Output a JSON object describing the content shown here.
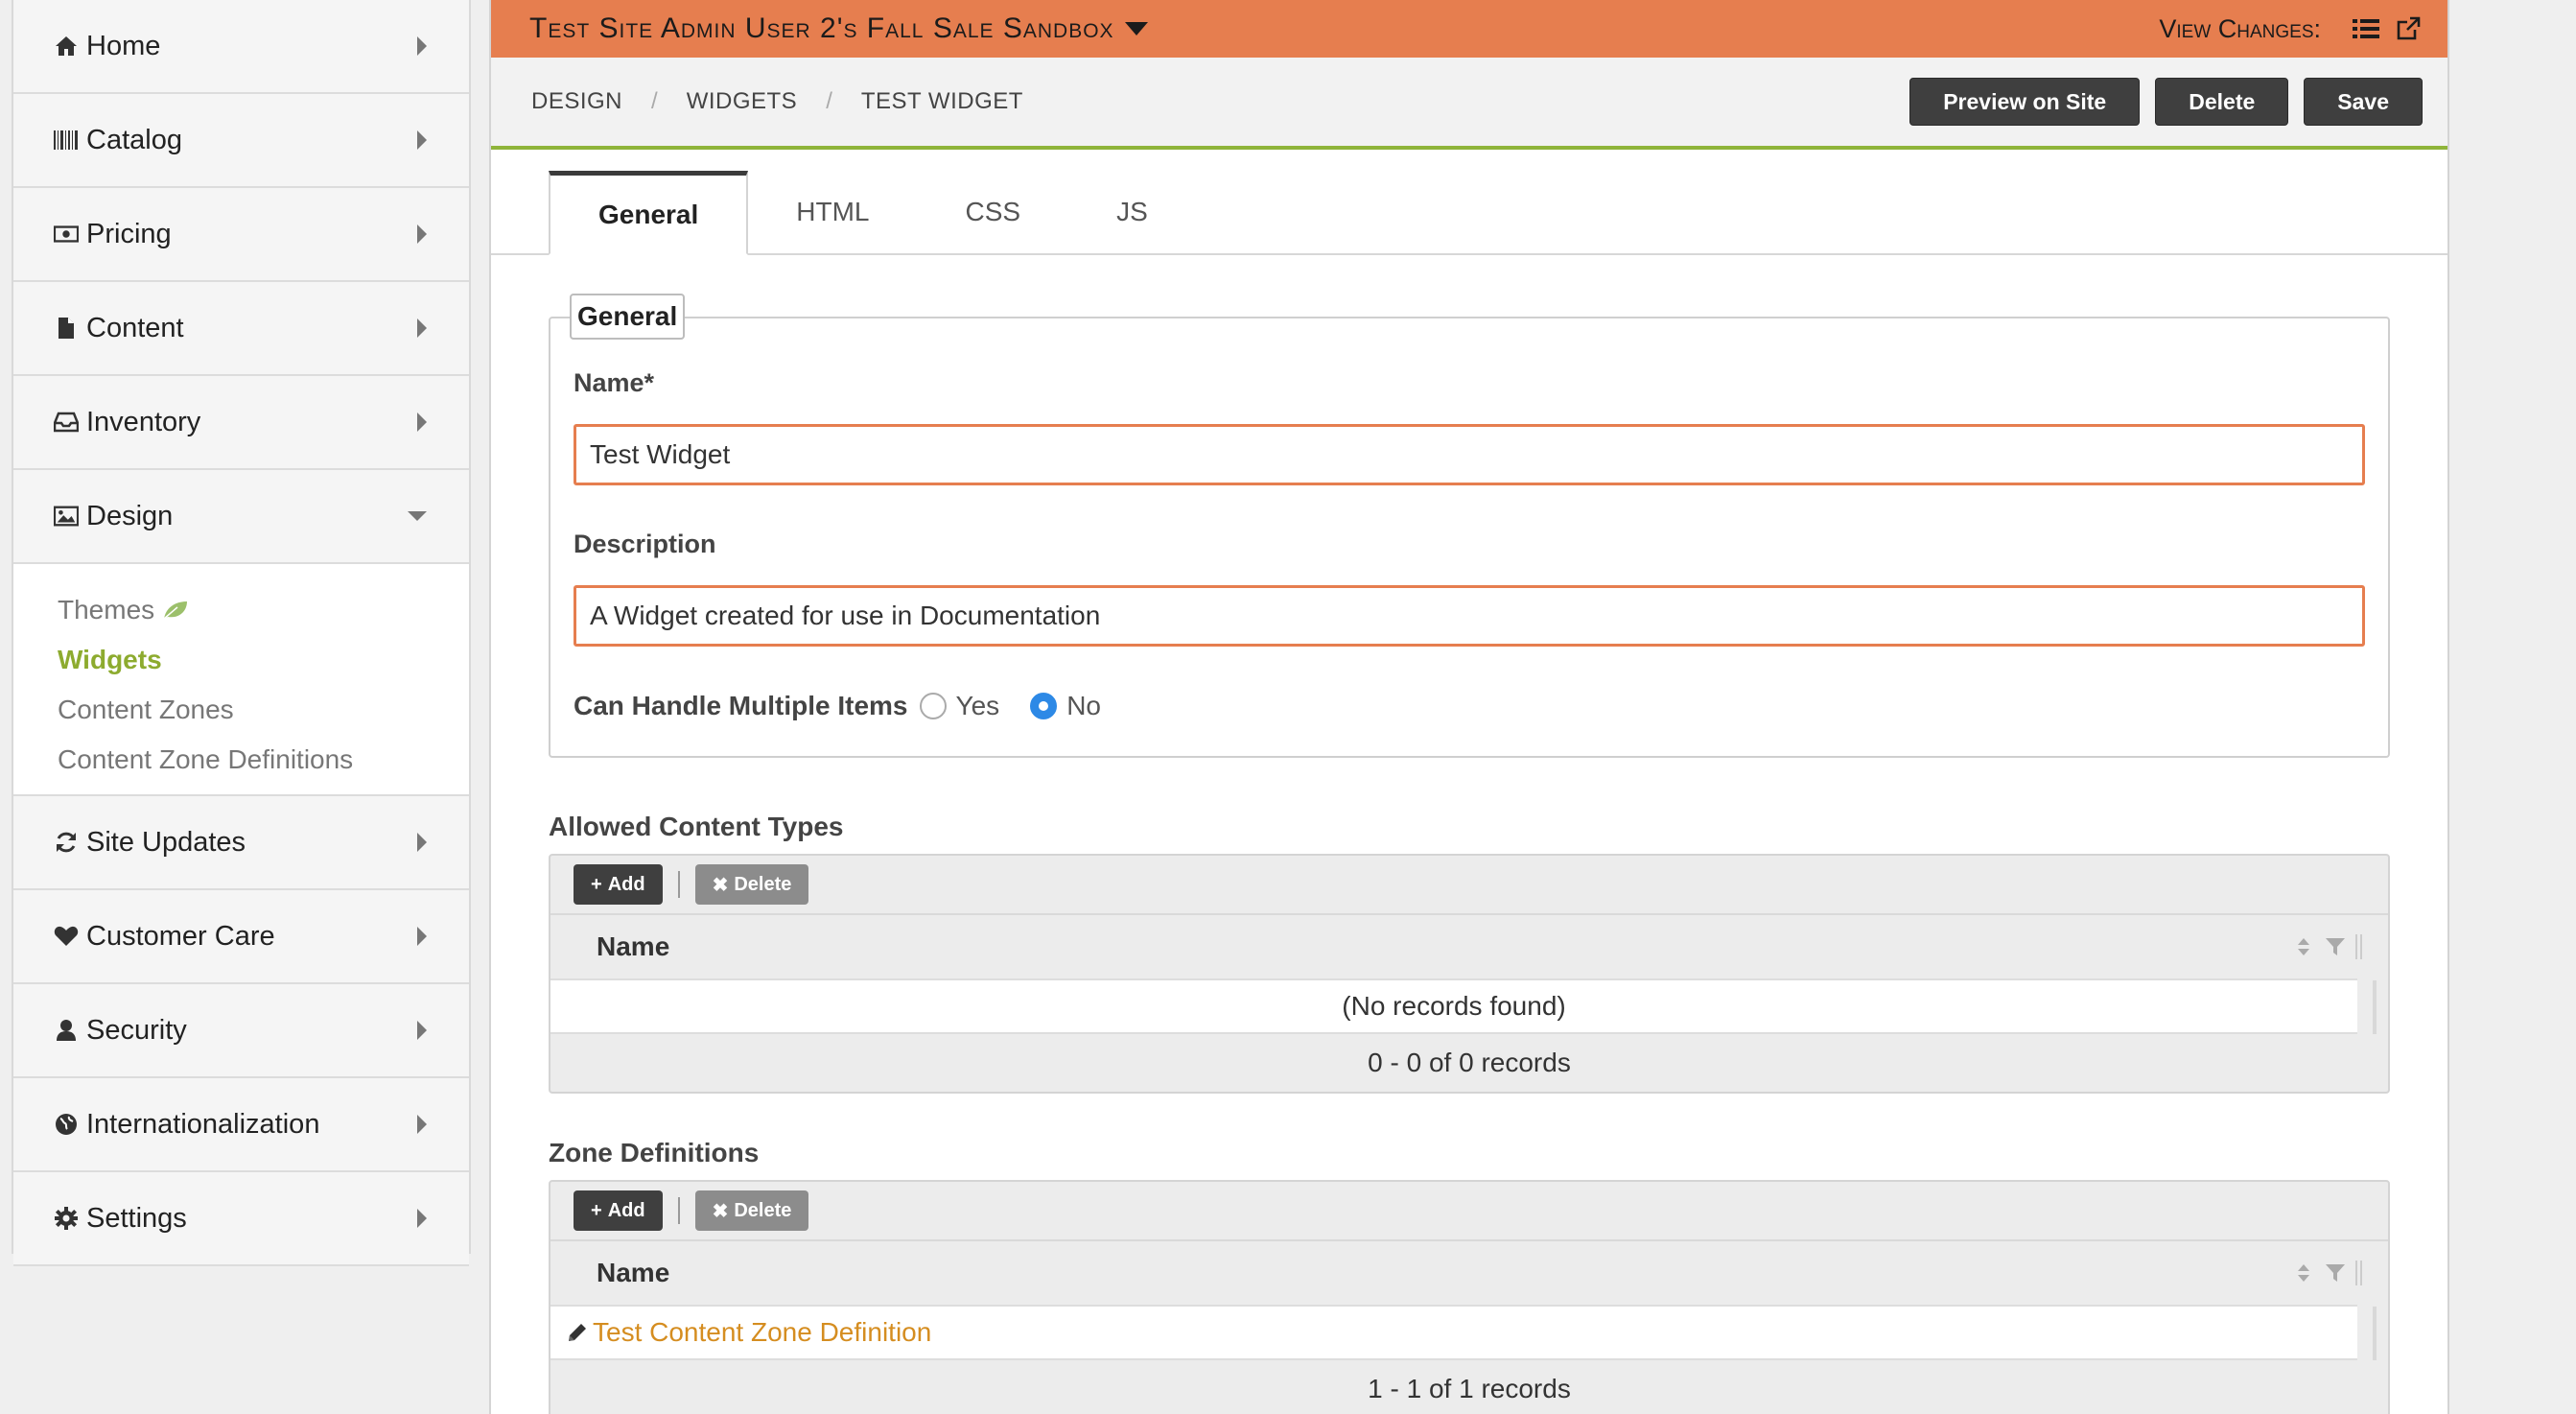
{
  "sidebar": {
    "items": [
      {
        "label": "Home",
        "icon": "home-icon"
      },
      {
        "label": "Catalog",
        "icon": "barcode-icon"
      },
      {
        "label": "Pricing",
        "icon": "money-icon"
      },
      {
        "label": "Content",
        "icon": "file-icon"
      },
      {
        "label": "Inventory",
        "icon": "inbox-icon"
      },
      {
        "label": "Design",
        "icon": "picture-icon"
      },
      {
        "label": "Site Updates",
        "icon": "refresh-icon"
      },
      {
        "label": "Customer Care",
        "icon": "heart-icon"
      },
      {
        "label": "Security",
        "icon": "user-icon"
      },
      {
        "label": "Internationalization",
        "icon": "globe-icon"
      },
      {
        "label": "Settings",
        "icon": "gear-icon"
      }
    ],
    "design_sub": [
      {
        "label": "Themes",
        "icon": "leaf-icon"
      },
      {
        "label": "Widgets"
      },
      {
        "label": "Content Zones"
      },
      {
        "label": "Content Zone Definitions"
      }
    ]
  },
  "topbar": {
    "site_title": "Test Site Admin User 2's Fall Sale Sandbox",
    "view_changes": "View Changes:",
    "accent": "#e67e4f"
  },
  "breadcrumb": {
    "items": [
      "DESIGN",
      "WIDGETS",
      "TEST WIDGET"
    ],
    "sep": "/"
  },
  "actions": {
    "preview": "Preview on Site",
    "delete": "Delete",
    "save": "Save"
  },
  "tabs": [
    "General",
    "HTML",
    "CSS",
    "JS"
  ],
  "form": {
    "legend": "General",
    "name_label": "Name*",
    "name_value": "Test Widget",
    "description_label": "Description",
    "description_value": "A Widget created for use in Documentation",
    "multi_label": "Can Handle Multiple Items",
    "yes": "Yes",
    "no": "No"
  },
  "allowed": {
    "title": "Allowed Content Types",
    "add": "Add",
    "delete": "Delete",
    "col_name": "Name",
    "empty": "(No records found)",
    "footer": "0 - 0 of 0 records"
  },
  "zones": {
    "title": "Zone Definitions",
    "add": "Add",
    "delete": "Delete",
    "col_name": "Name",
    "row": "Test Content Zone Definition",
    "footer": "1 - 1 of 1 records"
  }
}
